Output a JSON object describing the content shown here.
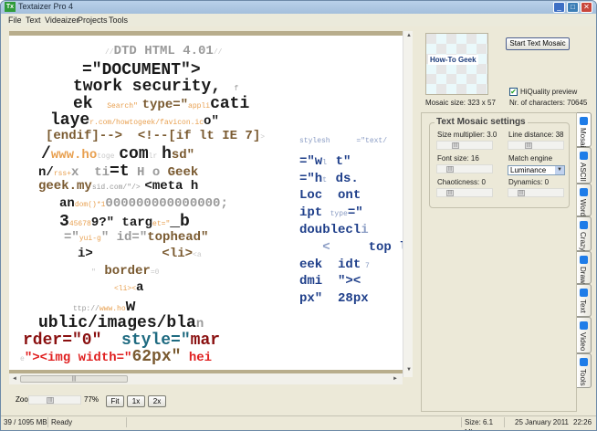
{
  "window": {
    "title": "Textaizer Pro 4",
    "app_icon": "Tx",
    "controls": {
      "minimize": "_",
      "maximize": "□",
      "close": "✕"
    }
  },
  "menu": [
    {
      "label": "File"
    },
    {
      "label": "Text"
    },
    {
      "label": "Videaizer"
    },
    {
      "label": "Projects"
    },
    {
      "label": "Tools"
    }
  ],
  "colors": {
    "black": "#1a1a1a",
    "gray": "#9a9a9a",
    "light": "#c8c8c8",
    "orange": "#e8a050",
    "brown": "#7a5a30",
    "blue": "#1f3f8a",
    "lightblue": "#8a9cc4",
    "red": "#e02020",
    "darkred": "#8a1010",
    "teal": "#1e6a80"
  },
  "mosaic": {
    "lines": [
      [
        {
          "t": "//",
          "c": "light",
          "s": "S"
        },
        {
          "t": "DTD HTML 4.01",
          "c": "gray",
          "s": "M"
        },
        {
          "t": "//",
          "c": "light",
          "s": "S"
        }
      ],
      [
        {
          "t": "=\"DOCUMENT\">",
          "c": "black",
          "s": "L"
        }
      ],
      [
        {
          "t": "twork security,",
          "c": "black",
          "s": "L"
        },
        {
          "t": "   f",
          "c": "gray",
          "s": "S"
        }
      ],
      [
        {
          "t": "ek ",
          "c": "black",
          "s": "L"
        },
        {
          "t": " Search\" ",
          "c": "orange",
          "s": "S"
        },
        {
          "t": "type=\"",
          "c": "brown",
          "s": "M"
        },
        {
          "t": "appli",
          "c": "orange",
          "s": "S"
        },
        {
          "t": "cati",
          "c": "black",
          "s": "L"
        }
      ],
      [
        {
          "t": "laye",
          "c": "black",
          "s": "L"
        },
        {
          "t": "r.com/howtogeek/favicon.ic",
          "c": "orange",
          "s": "S"
        },
        {
          "t": "o\"",
          "c": "black",
          "s": "M"
        }
      ],
      [
        {
          "t": "[endif]-->  <!--[if lt IE 7]",
          "c": "brown",
          "s": "M"
        },
        {
          "t": ">",
          "c": "light",
          "s": "S"
        }
      ],
      [
        {
          "t": "/",
          "c": "black",
          "s": "L"
        },
        {
          "t": "www.ho",
          "c": "orange",
          "s": "M"
        },
        {
          "t": "toge ",
          "c": "light",
          "s": "S"
        },
        {
          "t": "com",
          "c": "black",
          "s": "L"
        },
        {
          "t": "lr ",
          "c": "light",
          "s": "S"
        },
        {
          "t": "h",
          "c": "black",
          "s": "L"
        },
        {
          "t": "sd\"",
          "c": "brown",
          "s": "M"
        }
      ],
      [
        {
          "t": "n/",
          "c": "black",
          "s": "M"
        },
        {
          "t": "rss+",
          "c": "orange",
          "s": "S"
        },
        {
          "t": "x  ti",
          "c": "gray",
          "s": "M"
        },
        {
          "t": "=t",
          "c": "black",
          "s": "L"
        },
        {
          "t": " H o ",
          "c": "gray",
          "s": "M"
        },
        {
          "t": "Geek",
          "c": "brown",
          "s": "M"
        }
      ],
      [
        {
          "t": "geek.my",
          "c": "brown",
          "s": "M"
        },
        {
          "t": "sid.com/\"/> ",
          "c": "gray",
          "s": "S"
        },
        {
          "t": "<meta h",
          "c": "black",
          "s": "M"
        }
      ],
      [
        {
          "t": "an",
          "c": "black",
          "s": "M"
        },
        {
          "t": "dom()*1",
          "c": "orange",
          "s": "S"
        },
        {
          "t": "000000000000000;",
          "c": "gray",
          "s": "M"
        }
      ],
      [
        {
          "t": "3",
          "c": "black",
          "s": "L"
        },
        {
          "t": "45678",
          "c": "orange",
          "s": "S"
        },
        {
          "t": "9?\" targ",
          "c": "black",
          "s": "M"
        },
        {
          "t": "et=\"",
          "c": "orange",
          "s": "S"
        },
        {
          "t": "_b",
          "c": "black",
          "s": "L"
        }
      ],
      [
        {
          "t": "=\"",
          "c": "gray",
          "s": "M"
        },
        {
          "t": "yui-g",
          "c": "orange",
          "s": "S"
        },
        {
          "t": "\" id=\"",
          "c": "gray",
          "s": "M"
        },
        {
          "t": "tophead\"",
          "c": "brown",
          "s": "M"
        }
      ],
      [
        {
          "t": "i>",
          "c": "black",
          "s": "M"
        },
        {
          "t": "         <li>",
          "c": "brown",
          "s": "M"
        },
        {
          "t": "<a",
          "c": "light",
          "s": "S"
        }
      ],
      [
        {
          "t": "\"  ",
          "c": "light",
          "s": "S"
        },
        {
          "t": "border",
          "c": "brown",
          "s": "M"
        },
        {
          "t": "=0",
          "c": "light",
          "s": "S"
        }
      ],
      [
        {
          "t": "<li><",
          "c": "orange",
          "s": "S"
        },
        {
          "t": "a",
          "c": "black",
          "s": "M"
        }
      ],
      [
        {
          "t": "ttp://",
          "c": "gray",
          "s": "S"
        },
        {
          "t": "www.ho",
          "c": "orange",
          "s": "S"
        },
        {
          "t": "w",
          "c": "black",
          "s": "L"
        }
      ],
      [
        {
          "t": "ublic/images/bla",
          "c": "black",
          "s": "L"
        },
        {
          "t": "n",
          "c": "gray",
          "s": "M"
        }
      ],
      [
        {
          "t": "rder=\"0\"",
          "c": "darkred",
          "s": "L"
        },
        {
          "t": "  style=\"",
          "c": "teal",
          "s": "L"
        },
        {
          "t": "mar",
          "c": "darkred",
          "s": "L"
        }
      ],
      [
        {
          "t": "e",
          "c": "light",
          "s": "S"
        },
        {
          "t": "\"><img width=\"",
          "c": "red",
          "s": "M"
        },
        {
          "t": "62px\"",
          "c": "brown",
          "s": "L"
        },
        {
          "t": " hei",
          "c": "red",
          "s": "M"
        }
      ]
    ],
    "right_lines": [
      [
        {
          "t": "stylesh",
          "c": "lightblue",
          "s": "S"
        },
        {
          "t": "      =\"text/",
          "c": "lightblue",
          "s": "S"
        }
      ],
      [
        {
          "t": "=\"w",
          "c": "blue",
          "s": "M"
        },
        {
          "t": "l  ",
          "c": "lightblue",
          "s": "S"
        },
        {
          "t": "t\"",
          "c": "blue",
          "s": "M"
        }
      ],
      [
        {
          "t": "=\"h",
          "c": "blue",
          "s": "M"
        },
        {
          "t": "t  ",
          "c": "lightblue",
          "s": "S"
        },
        {
          "t": "ds.",
          "c": "blue",
          "s": "M"
        }
      ],
      [
        {
          "t": "Loc  ",
          "c": "blue",
          "s": "M"
        },
        {
          "t": "ont",
          "c": "blue",
          "s": "M"
        }
      ],
      [
        {
          "t": "ipt ",
          "c": "blue",
          "s": "M"
        },
        {
          "t": "type",
          "c": "lightblue",
          "s": "S"
        },
        {
          "t": "=\"",
          "c": "blue",
          "s": "M"
        }
      ],
      [
        {
          "t": "doublecl",
          "c": "blue",
          "s": "M"
        },
        {
          "t": "i",
          "c": "lightblue",
          "s": "M"
        }
      ],
      [
        {
          "t": "   <     ",
          "c": "lightblue",
          "s": "M"
        },
        {
          "t": "top ",
          "c": "blue",
          "s": "M"
        },
        {
          "t": "l",
          "c": "blue",
          "s": "M"
        }
      ],
      [
        {
          "t": "eek  ",
          "c": "blue",
          "s": "M"
        },
        {
          "t": "idt",
          "c": "blue",
          "s": "M"
        },
        {
          "t": " 7",
          "c": "lightblue",
          "s": "S"
        }
      ],
      [
        {
          "t": "dmi  ",
          "c": "blue",
          "s": "M"
        },
        {
          "t": "\"><",
          "c": "blue",
          "s": "M"
        }
      ],
      [
        {
          "t": "px\"  ",
          "c": "blue",
          "s": "M"
        },
        {
          "t": "28px",
          "c": "blue",
          "s": "M"
        }
      ]
    ]
  },
  "zoom": {
    "label": "Zoom",
    "value": "77%",
    "level": 0.4,
    "fit": "Fit",
    "one": "1x",
    "two": "2x"
  },
  "preview": {
    "logo_text": "How-To Geek",
    "start_button": "Start Text Mosaic",
    "hq_label": "HiQuality preview",
    "hq_checked": true,
    "mosaic_size": "Mosaic size: 323 x 57",
    "nr_chars": "Nr. of characters: 70645"
  },
  "settings": {
    "title": "Text Mosaic settings",
    "size_multiplier": "Size multiplier: 3.0",
    "line_distance": "Line distance: 38",
    "font_size": "Font size: 16",
    "match_engine": "Match engine",
    "match_value": "Luminance",
    "chaoticness": "Chaoticness: 0",
    "dynamics": "Dynamics: 0"
  },
  "tabs": [
    {
      "label": "Mosaic"
    },
    {
      "label": "ASCII"
    },
    {
      "label": "Word"
    },
    {
      "label": "Crazy"
    },
    {
      "label": "Draw"
    },
    {
      "label": "Text"
    },
    {
      "label": "Video"
    },
    {
      "label": "Tools"
    }
  ],
  "status": {
    "memory": "39 / 1095 MB",
    "state": "Ready",
    "size": "Size: 6.1 Mb",
    "date": "25 January 2011",
    "time": "22:26"
  }
}
